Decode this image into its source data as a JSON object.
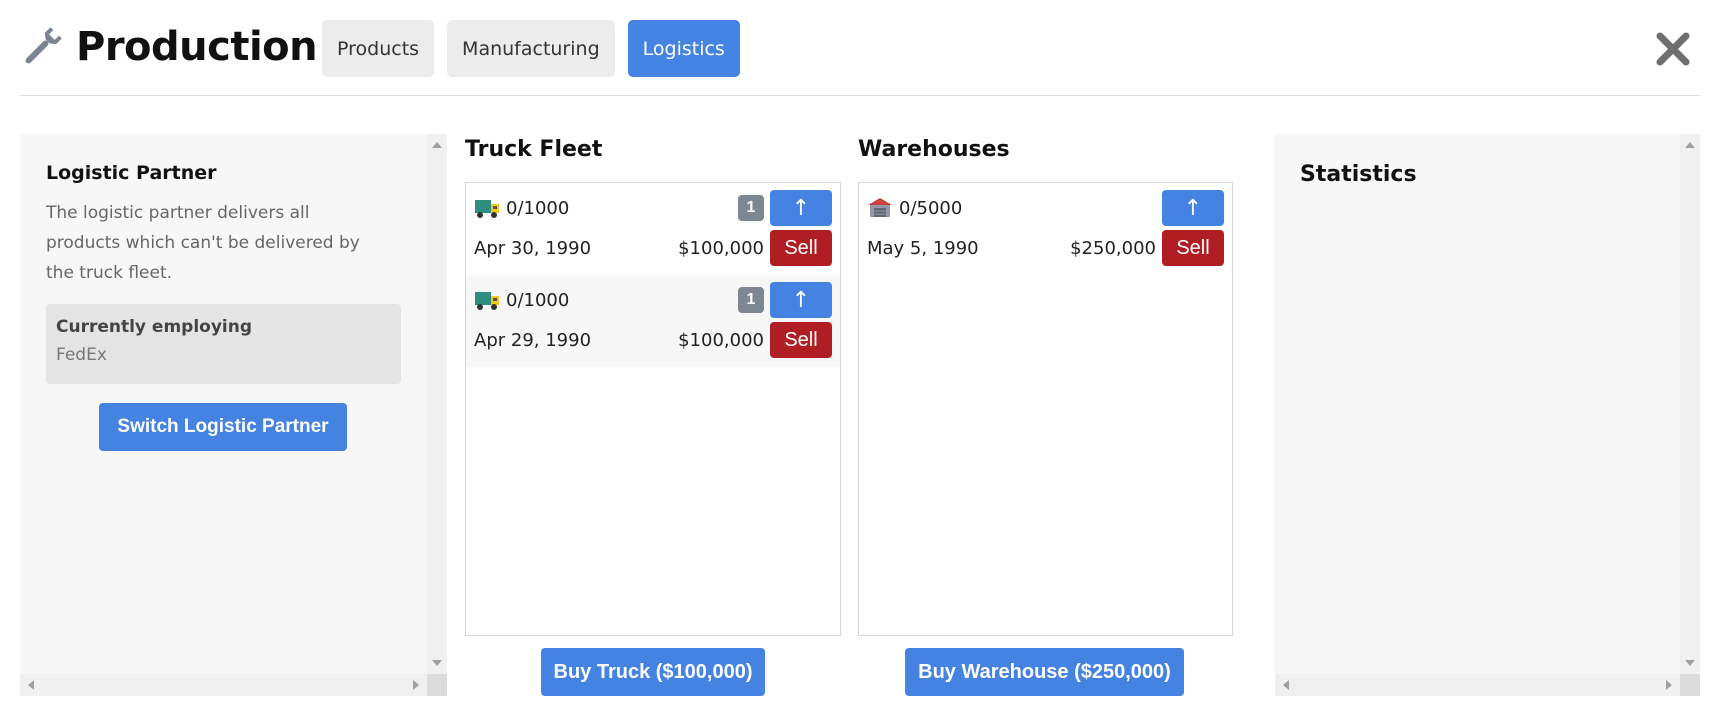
{
  "header": {
    "title": "Production",
    "tabs": [
      {
        "label": "Products",
        "active": false
      },
      {
        "label": "Manufacturing",
        "active": false
      },
      {
        "label": "Logistics",
        "active": true
      }
    ],
    "icon": "wrench-icon",
    "close_icon": "close-icon"
  },
  "logistic_partner": {
    "title": "Logistic Partner",
    "description": "The logistic partner delivers all products which can't be delivered by the truck fleet.",
    "employing_label": "Currently employing",
    "employing_value": "FedEx",
    "switch_label": "Switch Logistic Partner"
  },
  "truck_fleet": {
    "title": "Truck Fleet",
    "items": [
      {
        "capacity": "0/1000",
        "level": "1",
        "upgrade_label": "↑",
        "date": "Apr 30, 1990",
        "price": "$100,000",
        "sell_label": "Sell"
      },
      {
        "capacity": "0/1000",
        "level": "1",
        "upgrade_label": "↑",
        "date": "Apr 29, 1990",
        "price": "$100,000",
        "sell_label": "Sell"
      }
    ],
    "buy_label": "Buy Truck ($100,000)"
  },
  "warehouses": {
    "title": "Warehouses",
    "items": [
      {
        "capacity": "0/5000",
        "upgrade_label": "↑",
        "date": "May 5, 1990",
        "price": "$250,000",
        "sell_label": "Sell"
      }
    ],
    "buy_label": "Buy Warehouse ($250,000)"
  },
  "statistics": {
    "title": "Statistics"
  },
  "colors": {
    "accent": "#4483e2",
    "danger": "#b01e23",
    "badge": "#7d8794"
  }
}
